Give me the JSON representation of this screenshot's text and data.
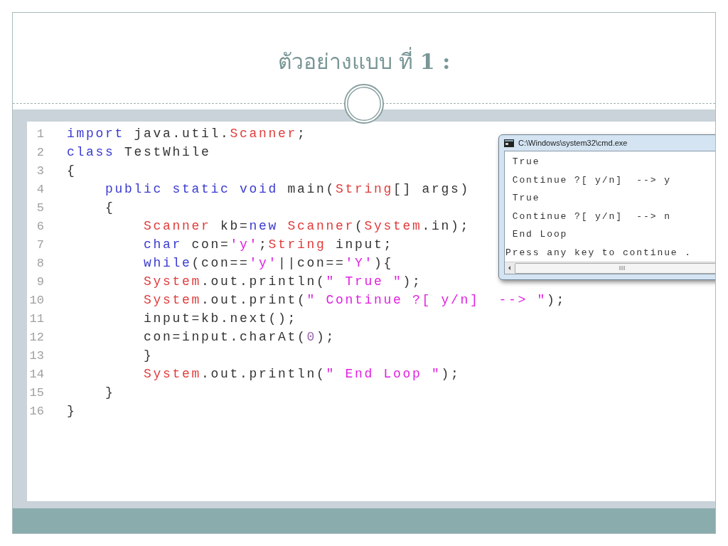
{
  "slide": {
    "title": "ตัวอย่างแบบ ที่ **1 :**"
  },
  "code_editor": {
    "lines": [
      {
        "number": "1",
        "tokens": [
          {
            "kind": "keyword",
            "text": "import"
          },
          {
            "kind": "plain",
            "text": " java.util."
          },
          {
            "kind": "type",
            "text": "Scanner"
          },
          {
            "kind": "plain",
            "text": ";"
          }
        ]
      },
      {
        "number": "2",
        "tokens": [
          {
            "kind": "keyword",
            "text": "class"
          },
          {
            "kind": "plain",
            "text": " TestWhile"
          }
        ]
      },
      {
        "number": "3",
        "tokens": [
          {
            "kind": "plain",
            "text": "{"
          }
        ]
      },
      {
        "number": "4",
        "tokens": [
          {
            "kind": "keyword",
            "text": "    public static void"
          },
          {
            "kind": "plain",
            "text": " main("
          },
          {
            "kind": "type",
            "text": "String"
          },
          {
            "kind": "plain",
            "text": "[] args)"
          }
        ]
      },
      {
        "number": "5",
        "tokens": [
          {
            "kind": "plain",
            "text": "    {"
          }
        ]
      },
      {
        "number": "6",
        "tokens": [
          {
            "kind": "type",
            "text": "        Scanner"
          },
          {
            "kind": "plain",
            "text": " kb="
          },
          {
            "kind": "keyword",
            "text": "new"
          },
          {
            "kind": "type",
            "text": " Scanner"
          },
          {
            "kind": "plain",
            "text": "("
          },
          {
            "kind": "type",
            "text": "System"
          },
          {
            "kind": "plain",
            "text": ".in);"
          }
        ]
      },
      {
        "number": "7",
        "tokens": [
          {
            "kind": "keyword",
            "text": "        char"
          },
          {
            "kind": "plain",
            "text": " con="
          },
          {
            "kind": "string",
            "text": "'y'"
          },
          {
            "kind": "plain",
            "text": ";"
          },
          {
            "kind": "type",
            "text": "String"
          },
          {
            "kind": "plain",
            "text": " input;"
          }
        ]
      },
      {
        "number": "8",
        "tokens": [
          {
            "kind": "keyword",
            "text": "        while"
          },
          {
            "kind": "plain",
            "text": "(con=="
          },
          {
            "kind": "string",
            "text": "'y'"
          },
          {
            "kind": "plain",
            "text": "||con=="
          },
          {
            "kind": "string",
            "text": "'Y'"
          },
          {
            "kind": "plain",
            "text": "){"
          }
        ]
      },
      {
        "number": "9",
        "tokens": [
          {
            "kind": "type",
            "text": "        System"
          },
          {
            "kind": "plain",
            "text": ".out.println("
          },
          {
            "kind": "string",
            "text": "\" True \""
          },
          {
            "kind": "plain",
            "text": ");"
          }
        ]
      },
      {
        "number": "10",
        "tokens": [
          {
            "kind": "type",
            "text": "        System"
          },
          {
            "kind": "plain",
            "text": ".out.print("
          },
          {
            "kind": "string",
            "text": "\" Continue ?[ y/n]  --> \""
          },
          {
            "kind": "plain",
            "text": ");"
          }
        ]
      },
      {
        "number": "11",
        "tokens": [
          {
            "kind": "plain",
            "text": "        input=kb.next();"
          }
        ]
      },
      {
        "number": "12",
        "tokens": [
          {
            "kind": "plain",
            "text": "        con=input.charAt("
          },
          {
            "kind": "number",
            "text": "0"
          },
          {
            "kind": "plain",
            "text": ");"
          }
        ]
      },
      {
        "number": "13",
        "tokens": [
          {
            "kind": "plain",
            "text": "        }"
          }
        ]
      },
      {
        "number": "14",
        "tokens": [
          {
            "kind": "type",
            "text": "        System"
          },
          {
            "kind": "plain",
            "text": ".out.println("
          },
          {
            "kind": "string",
            "text": "\" End Loop \""
          },
          {
            "kind": "plain",
            "text": ");"
          }
        ]
      },
      {
        "number": "15",
        "tokens": [
          {
            "kind": "plain",
            "text": "    }"
          }
        ]
      },
      {
        "number": "16",
        "tokens": [
          {
            "kind": "plain",
            "text": "}"
          }
        ]
      }
    ]
  },
  "console_window": {
    "title": "C:\\Windows\\system32\\cmd.exe",
    "output": [
      " True",
      " Continue ?[ y/n]  --> y",
      " True",
      " Continue ?[ y/n]  --> n",
      " End Loop",
      "Press any key to continue ."
    ]
  }
}
